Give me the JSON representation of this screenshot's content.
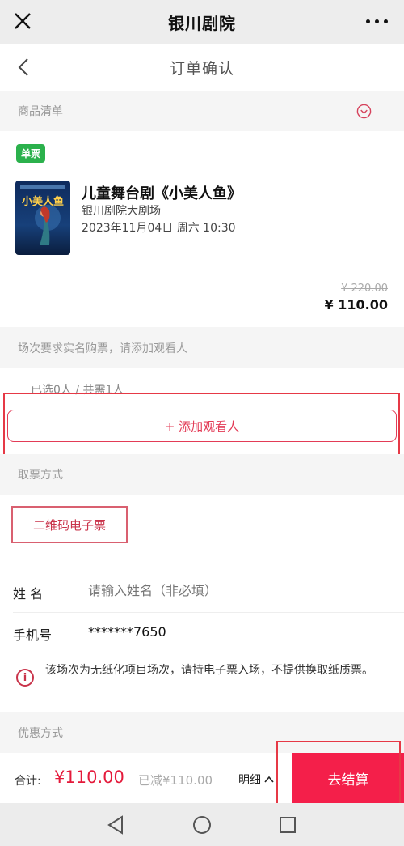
{
  "app": {
    "title": "银川剧院",
    "close_icon": "close-icon",
    "more_icon": "more-dots-icon"
  },
  "nav": {
    "title": "订单确认",
    "back_icon": "back-arrow-icon"
  },
  "goods": {
    "section_label": "商品清单",
    "badge": "单票",
    "show_title": "儿童舞台剧《小美人鱼》",
    "venue": "银川剧院大剧场",
    "datetime": "2023年11月04日 周六 10:30",
    "original_price": "¥ 220.00",
    "price": "¥ 110.00"
  },
  "viewers": {
    "section_label": "场次要求实名购票，请添加观看人",
    "selected_text": "已选0人 / 共需1人",
    "add_button": "+ 添加观看人"
  },
  "pickup": {
    "section_label": "取票方式",
    "method_button": "二维码电子票"
  },
  "form": {
    "name_label": "姓 名",
    "name_placeholder": "请输入姓名（非必填）",
    "phone_label": "手机号",
    "phone_value": "*******7650"
  },
  "notice": {
    "text": "该场次为无纸化项目场次，请持电子票入场，不提供换取纸质票。"
  },
  "discount": {
    "section_label": "优惠方式"
  },
  "footer": {
    "total_label": "合计:",
    "total_value": "¥110.00",
    "discount_text": "已减¥110.00",
    "detail_label": "明细",
    "checkout_label": "去结算"
  },
  "colors": {
    "accent": "#f41f4a",
    "badge_green": "#2bb14c",
    "annotation_red": "#e63946"
  }
}
